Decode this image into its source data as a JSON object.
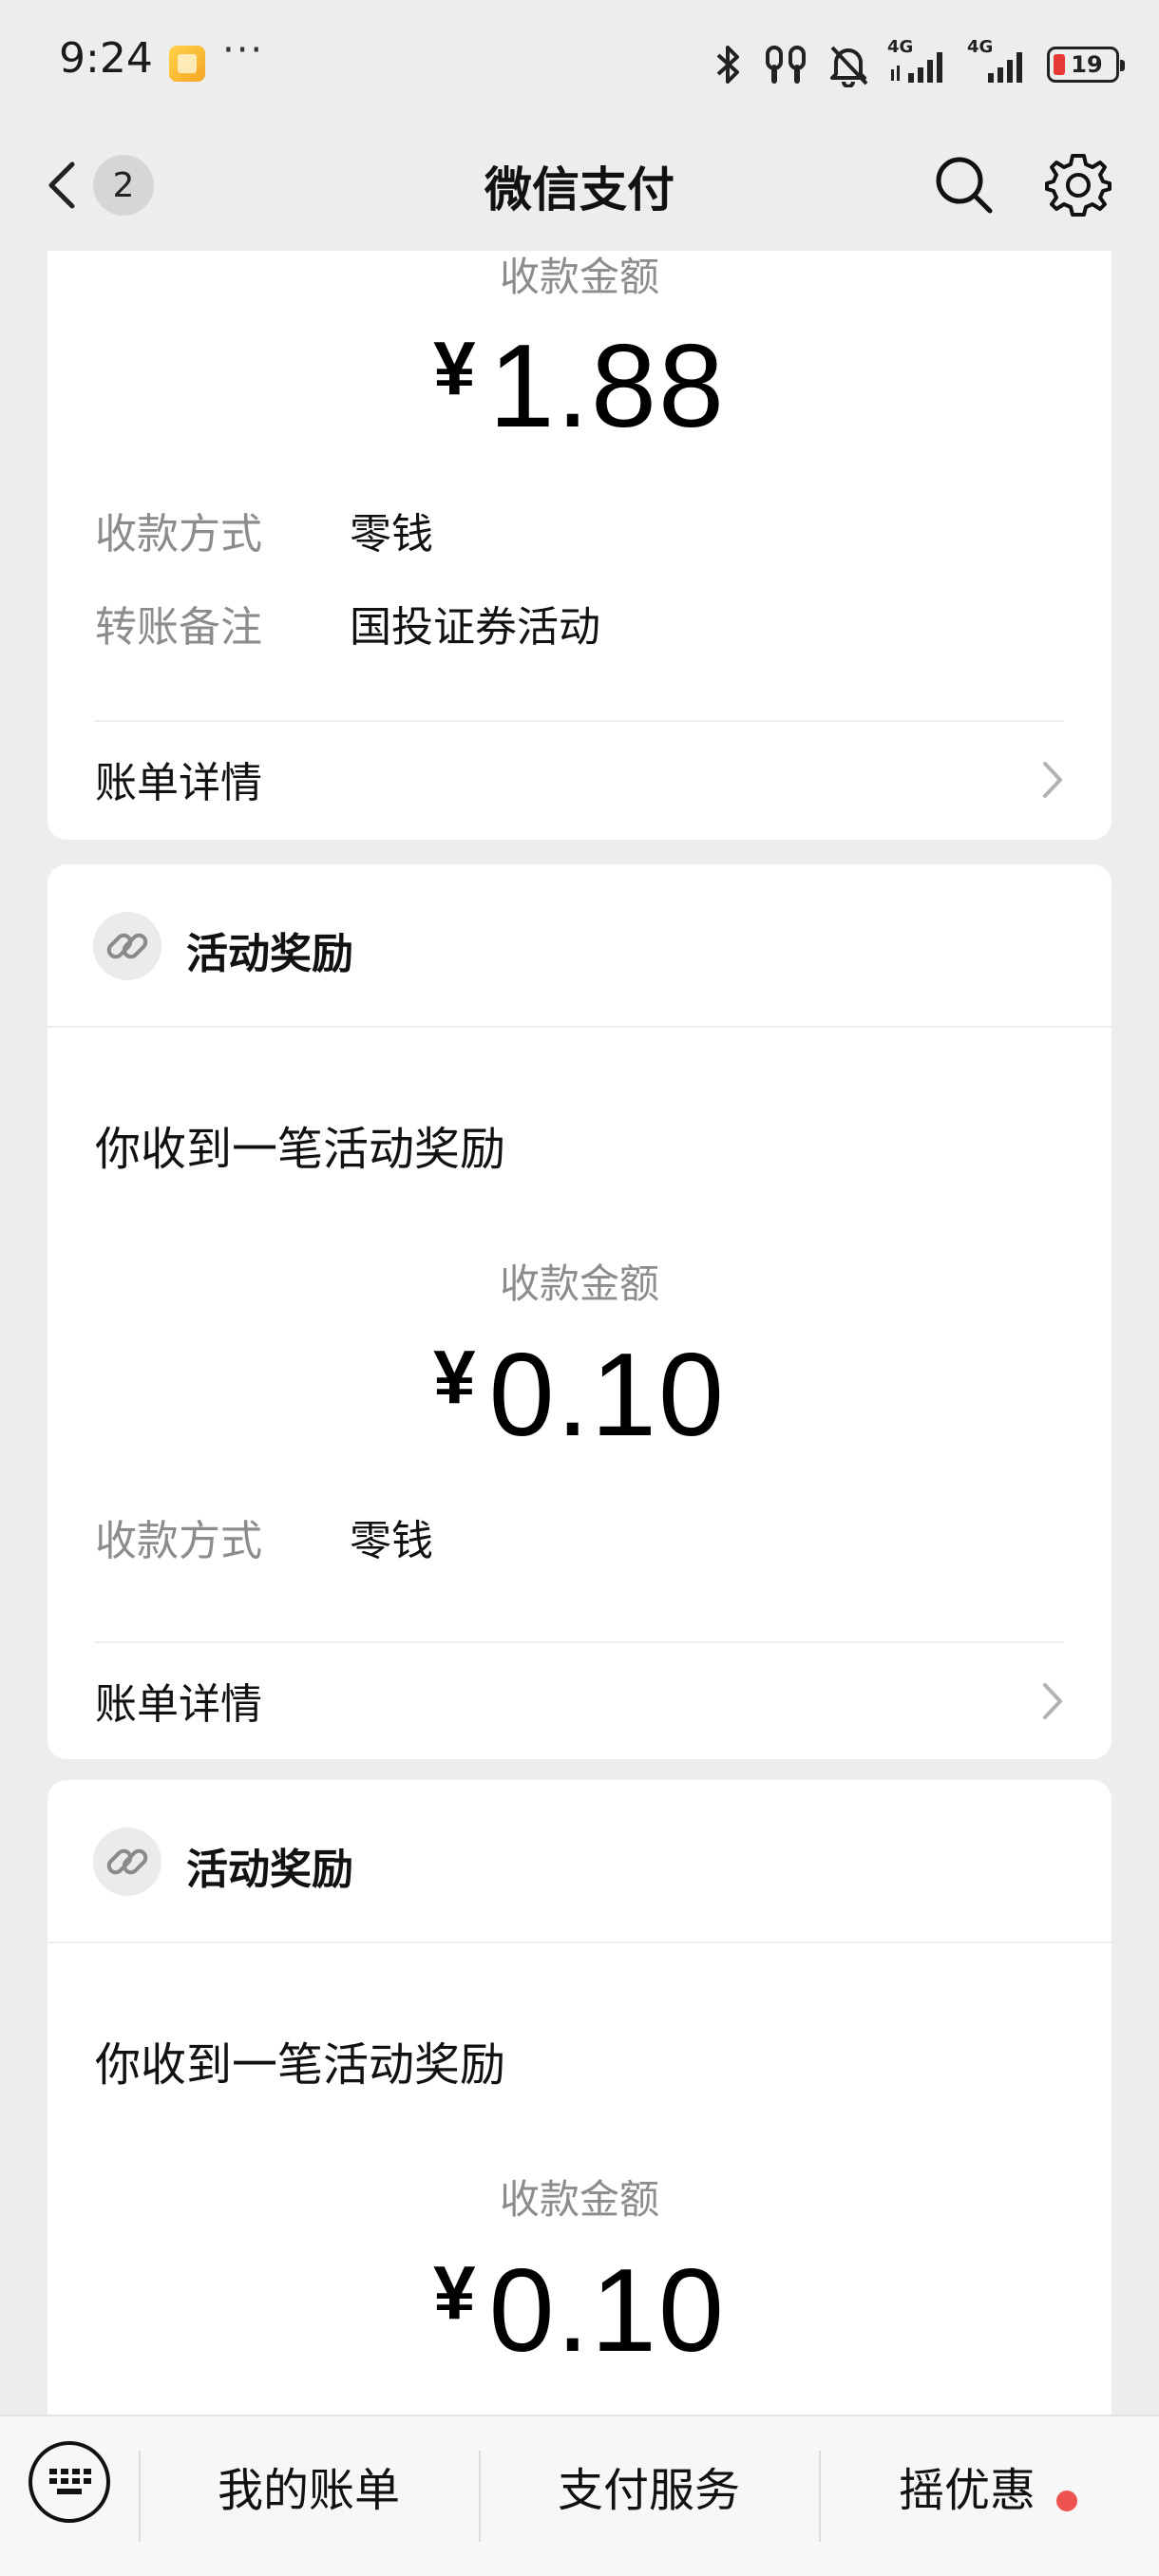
{
  "status_bar": {
    "time": "9:24",
    "more": "···",
    "network_1": "4G",
    "network_2": "4G",
    "battery": "19"
  },
  "nav": {
    "title": "微信支付",
    "back_badge": "2"
  },
  "cards": [
    {
      "amount_label": "收款金额",
      "currency": "¥",
      "amount": "1.88",
      "rows": [
        {
          "key": "收款方式",
          "value": "零钱"
        },
        {
          "key": "转账备注",
          "value": "国投证券活动"
        }
      ],
      "bill_details": "账单详情"
    },
    {
      "header": "活动奖励",
      "message": "你收到一笔活动奖励",
      "amount_label": "收款金额",
      "currency": "¥",
      "amount": "0.10",
      "rows": [
        {
          "key": "收款方式",
          "value": "零钱"
        }
      ],
      "bill_details": "账单详情"
    },
    {
      "header": "活动奖励",
      "message": "你收到一笔活动奖励",
      "amount_label": "收款金额",
      "currency": "¥",
      "amount": "0.10"
    }
  ],
  "bottom_bar": {
    "items": [
      "我的账单",
      "支付服务",
      "摇优惠"
    ]
  },
  "colors": {
    "background": "#ededed",
    "card": "#ffffff",
    "muted_text": "#8c8c8c",
    "notification_dot": "#ef5350"
  },
  "icons": [
    "bluetooth-icon",
    "earbuds-icon",
    "mute-bell-icon",
    "signal-icon",
    "battery-icon",
    "back-chevron-icon",
    "search-icon",
    "gear-icon",
    "link-chain-icon",
    "chevron-right-icon",
    "keyboard-icon"
  ]
}
